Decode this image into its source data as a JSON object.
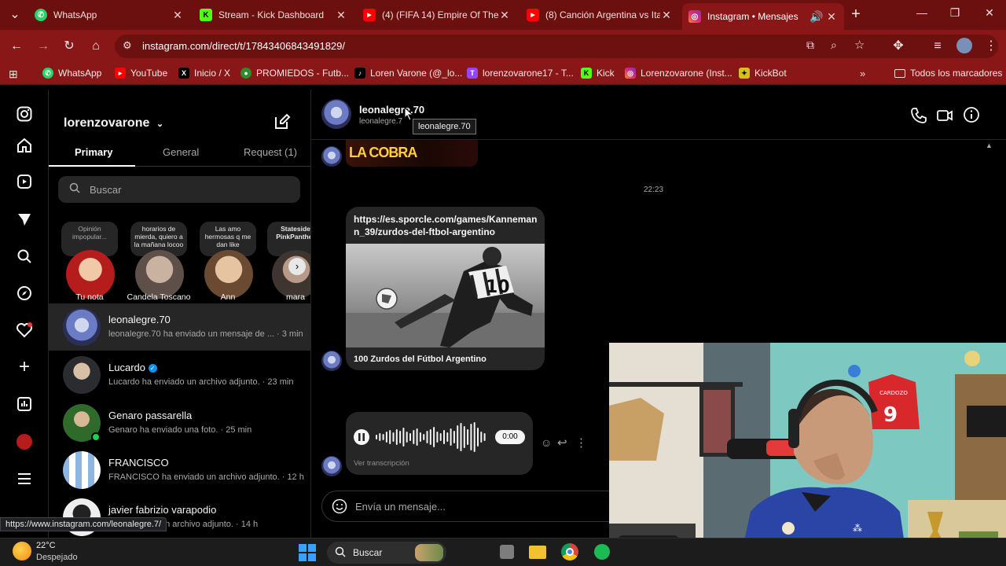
{
  "browser": {
    "tabs": [
      {
        "title": "WhatsApp",
        "color": "#25d366",
        "glyph": "✆"
      },
      {
        "title": "Stream - Kick Dashboard",
        "color": "#53fc18",
        "glyph": "K"
      },
      {
        "title": "(4) (FIFA 14) Empire Of The S",
        "color": "#ff0000",
        "glyph": "▶"
      },
      {
        "title": "(8) Canción Argentina vs Ita",
        "color": "#ff0000",
        "glyph": "▶"
      },
      {
        "title": "Instagram • Mensajes",
        "color": "#e1306c",
        "glyph": "◎"
      }
    ],
    "url": "instagram.com/direct/t/17843406843491829/",
    "bookmarks": [
      {
        "label": "WhatsApp",
        "color": "#25d366",
        "glyph": "✆"
      },
      {
        "label": "YouTube",
        "color": "#ff0000",
        "glyph": "▶"
      },
      {
        "label": "Inicio / X",
        "color": "#000000",
        "glyph": "X"
      },
      {
        "label": "PROMIEDOS - Futb...",
        "color": "#2e8b2e",
        "glyph": "●"
      },
      {
        "label": "Loren Varone (@_lo...",
        "color": "#000000",
        "glyph": "♪"
      },
      {
        "label": "lorenzovarone17 - T...",
        "color": "#9146ff",
        "glyph": "T"
      },
      {
        "label": "Kick",
        "color": "#53fc18",
        "glyph": "K"
      },
      {
        "label": "Lorenzovarone (Inst...",
        "color": "#e1306c",
        "glyph": "◎"
      },
      {
        "label": "KickBot",
        "color": "#d4c21a",
        "glyph": "✦"
      }
    ],
    "all_bookmarks": "Todos los marcadores",
    "status_url": "https://www.instagram.com/leonalegre.7/"
  },
  "inbox": {
    "username": "lorenzovarone",
    "tabs": [
      "Primary",
      "General",
      "Request (1)"
    ],
    "search_placeholder": "Buscar",
    "notes": [
      {
        "text": "Opinión impopular...",
        "name": "Tu nota",
        "color": "#b51c1c"
      },
      {
        "text": "horarios de mierda, quiero a la mañana locoo",
        "name": "Candela Toscano",
        "color": "#8a7a6e"
      },
      {
        "text": "Las amo hermosas q me dan like",
        "name": "Ann",
        "color": "#a48466"
      },
      {
        "text": "Stateside PinkPanther",
        "name": "mara",
        "color": "#6a5a54"
      }
    ],
    "threads": [
      {
        "name": "leonalegre.70",
        "preview": "leonalegre.70 ha enviado un mensaje de ... · 3 min",
        "color": "#6b7cc4",
        "selected": true
      },
      {
        "name": "Lucardo",
        "preview": "Lucardo ha enviado un archivo adjunto. · 23 min",
        "color": "#4a4f55",
        "verified": true
      },
      {
        "name": "Genaro passarella",
        "preview": "Genaro ha enviado una foto. · 25 min",
        "color": "#3e6b2e",
        "online": true
      },
      {
        "name": "FRANCISCO",
        "preview": "FRANCISCO ha enviado un archivo adjunto. · 12 h",
        "color": "#5a86b8"
      },
      {
        "name": "javier fabrizio varapodio",
        "preview": "un archivo adjunto. · 14 h",
        "color": "#ddd"
      }
    ]
  },
  "chat": {
    "contact_name": "leonalegre.70",
    "contact_handle": "leonalegre.7",
    "tooltip": "leonalegre.70",
    "timestamp": "22:23",
    "link_url": "https://es.sporcle.com/games/Kannemann_39/zurdos-del-ftbol-argentino",
    "link_title": "100 Zurdos del Fútbol Argentino",
    "audio_time": "0:00",
    "transcription": "Ver transcripción",
    "composer_placeholder": "Envía un mensaje...",
    "top_image_text": "LA COBRA"
  },
  "taskbar": {
    "temp": "22°C",
    "weather": "Despejado",
    "search": "Buscar"
  },
  "webcam": {
    "jersey_number": "9",
    "jersey_name": "CARDOZO"
  }
}
